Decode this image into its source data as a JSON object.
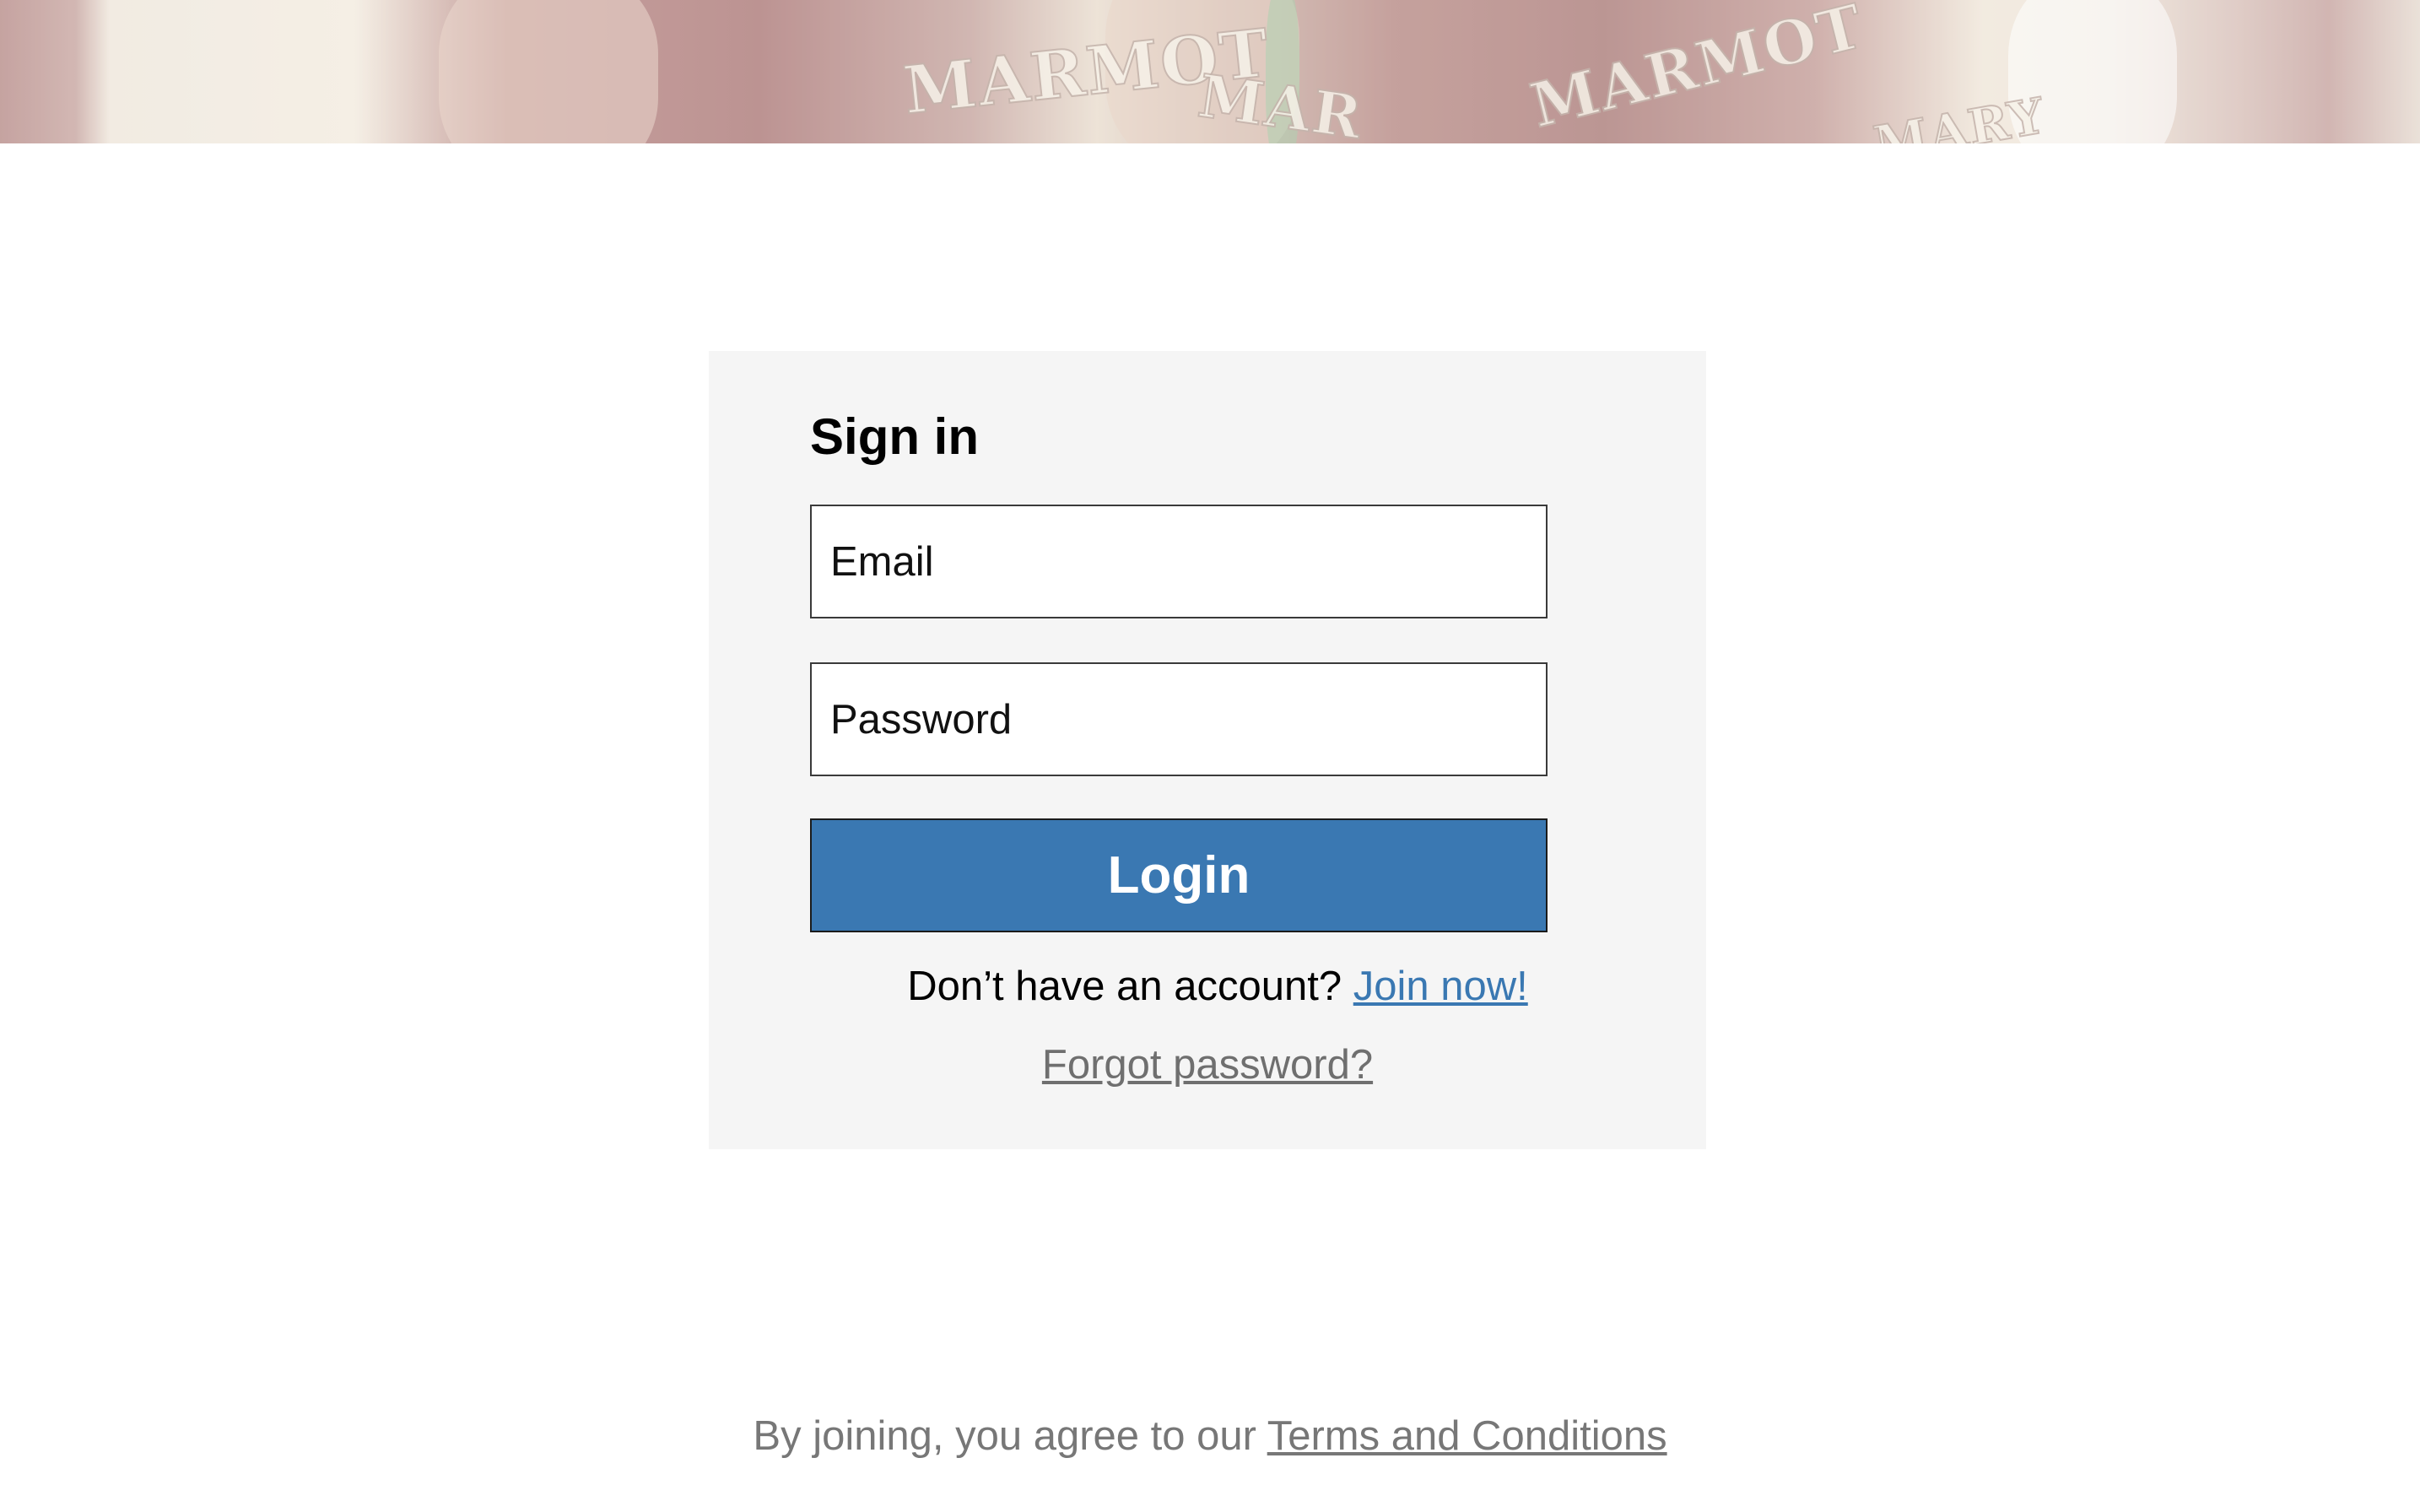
{
  "hero": {
    "image_alt": "Team players in maroon jerseys",
    "jersey_texts": [
      "MARMOT",
      "MAR",
      "MARMOT",
      "MARY"
    ]
  },
  "signin": {
    "title": "Sign in",
    "email_placeholder": "Email",
    "password_placeholder": "Password",
    "login_label": "Login",
    "no_account_text": "Don’t have an account?",
    "join_label": "Join now!",
    "forgot_label": "Forgot password?"
  },
  "footer": {
    "agree_text": "By joining, you agree to our",
    "terms_label": "Terms and Conditions"
  },
  "colors": {
    "primary": "#3a78b2",
    "card_background": "#f5f5f5",
    "muted_text": "#777777"
  }
}
